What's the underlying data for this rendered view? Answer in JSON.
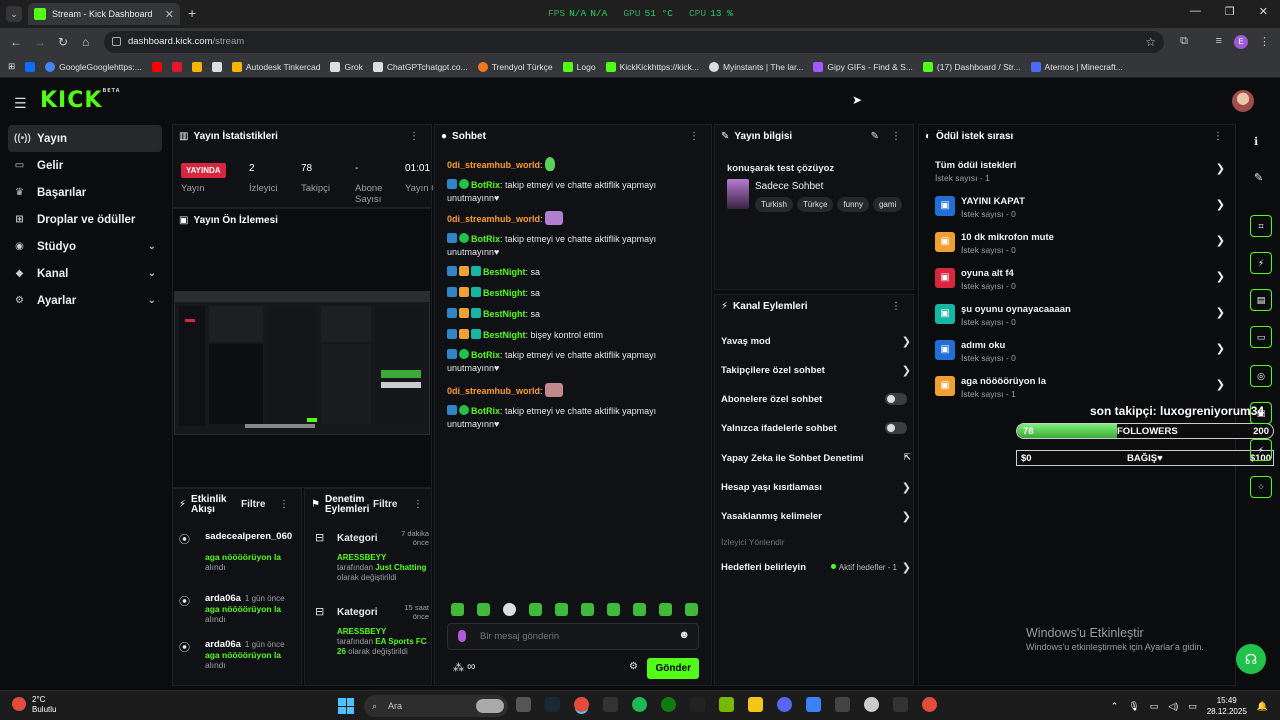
{
  "browser": {
    "tab_title": "Stream - Kick Dashboard",
    "hud": {
      "fps_label": "FPS",
      "fps_value": "N/A",
      "fps_value2": "N/A",
      "gpu_label": "GPU",
      "gpu_value": "51 °C",
      "cpu_label": "CPU",
      "cpu_value": "13 %"
    },
    "url_domain": "dashboard.kick.com",
    "url_path": "/stream",
    "profile_letter": "E",
    "bookmarks": [
      {
        "label": "GoogleGooglehttps:...",
        "color": "#4285f4"
      },
      {
        "label": "",
        "color": "#ff0000"
      },
      {
        "label": "",
        "color": "#e6162d"
      },
      {
        "label": "",
        "color": "#f5b400"
      },
      {
        "label": "Autodesk Tinkercad",
        "color": "#f5b400"
      },
      {
        "label": "Grok",
        "color": "#e0e0e0"
      },
      {
        "label": "ChatGPTchatgpt.co...",
        "color": "#e0e0e0"
      },
      {
        "label": "Trendyol Türkçe",
        "color": "#f27a1a"
      },
      {
        "label": "Logo",
        "color": "#53fc18"
      },
      {
        "label": "KickKickhttps://kick...",
        "color": "#53fc18"
      },
      {
        "label": "Myinstants | The lar...",
        "color": "#e0e0e0"
      },
      {
        "label": "Gipy GIFs - Find & S...",
        "color": "#a259ff"
      },
      {
        "label": "(17) Dashboard / Str...",
        "color": "#53fc18"
      },
      {
        "label": "Aternos | Minecraft...",
        "color": "#4a6cf7"
      }
    ]
  },
  "kick": {
    "logo": "KICK",
    "logo_sup": "BETA"
  },
  "sidebar": {
    "items": [
      {
        "label": "Yayın",
        "icon": "broadcast-icon",
        "glyph": "((•))",
        "chev": ""
      },
      {
        "label": "Gelir",
        "icon": "money-icon",
        "glyph": "▭",
        "chev": ""
      },
      {
        "label": "Başarılar",
        "icon": "trophy-icon",
        "glyph": "🏆",
        "chev": ""
      },
      {
        "label": "Droplar ve ödüller",
        "icon": "gift-icon",
        "glyph": "⊞",
        "chev": ""
      },
      {
        "label": "Stüdyo",
        "icon": "studio-icon",
        "glyph": "◉",
        "chev": "⌄"
      },
      {
        "label": "Kanal",
        "icon": "channel-icon",
        "glyph": "◆",
        "chev": "⌄"
      },
      {
        "label": "Ayarlar",
        "icon": "settings-icon",
        "glyph": "⚙",
        "chev": "⌄"
      }
    ]
  },
  "stats": {
    "title": "Yayın İstatistikleri",
    "live_badge": "YAYINDA",
    "live_label": "Yayın",
    "viewers": "2",
    "viewers_label": "İzleyici",
    "followers": "78",
    "followers_label": "Takipçi",
    "subs": "-",
    "subs_label": "Abone Sayısı",
    "time": "01:01",
    "time_label": "Yayın Oldu"
  },
  "preview": {
    "title": "Yayın Ön İzlemesi"
  },
  "activity": {
    "title": "Etkinlik Akışı",
    "filter": "Filtre",
    "items": [
      {
        "name": "sadecealperen_060",
        "time": "",
        "reward": "aga nöööörüyon la",
        "sub": "alındı"
      },
      {
        "name": "arda06a",
        "time": "1 gün önce",
        "reward": "aga nöööörüyon la",
        "sub": "alındı"
      },
      {
        "name": "arda06a",
        "time": "1 gün önce",
        "reward": "aga nöööörüyon la",
        "sub": "alındı"
      }
    ]
  },
  "audit": {
    "title": "Denetim Eylemleri",
    "filter": "Filtre",
    "items": [
      {
        "label": "Kategori",
        "time": "7 dakika önce",
        "user": "ARESSBEYY",
        "by": "tarafından",
        "game": "Just Chatting",
        "end": "olarak değiştirildi"
      },
      {
        "label": "Kategori",
        "time": "15 saat önce",
        "user": "ARESSBEYY",
        "by": "tarafından",
        "game": "EA Sports FC 26",
        "end": "olarak değiştirildi"
      }
    ]
  },
  "chat": {
    "title": "Sohbet",
    "lines": [
      {
        "name": "0di_streamhub_world",
        "type": "odi",
        "text": ""
      },
      {
        "name": "BotRix",
        "type": "bot",
        "text": "takip etmeyi ve chatte aktiflik yapmayı unutmayınn♥"
      },
      {
        "name": "0di_streamhub_world",
        "type": "odi",
        "text": ""
      },
      {
        "name": "BotRix",
        "type": "bot",
        "text": "takip etmeyi ve chatte aktiflik yapmayı unutmayınn♥"
      },
      {
        "name": "BestNight",
        "type": "best",
        "text": "sa"
      },
      {
        "name": "BestNight",
        "type": "best",
        "text": "sa"
      },
      {
        "name": "BestNight",
        "type": "best",
        "text": "sa"
      },
      {
        "name": "BestNight",
        "type": "best",
        "text": "bişey kontrol ettim"
      },
      {
        "name": "BotRix",
        "type": "bot",
        "text": "takip etmeyi ve chatte aktiflik yapmayı unutmayınn♥"
      },
      {
        "name": "0di_streamhub_world",
        "type": "odi",
        "text": ""
      },
      {
        "name": "BotRix",
        "type": "bot",
        "text": "takip etmeyi ve chatte aktiflik yapmayı unutmayınn♥"
      }
    ],
    "placeholder": "Bir mesaj gönderin",
    "send": "Gönder"
  },
  "stream_info": {
    "title": "Yayın bilgisi",
    "stream_title": "konuşarak test çözüyoz",
    "category": "Sadece Sohbet",
    "tags": [
      "Turkish",
      "Türkçe",
      "funny",
      "gami"
    ]
  },
  "channel_actions": {
    "title": "Kanal Eylemleri",
    "items": [
      {
        "label": "Yavaş mod",
        "kind": "arrow"
      },
      {
        "label": "Takipçilere özel sohbet",
        "kind": "arrow"
      },
      {
        "label": "Abonelere özel sohbet",
        "kind": "toggle"
      },
      {
        "label": "Yalnızca ifadelerle sohbet",
        "kind": "toggle"
      },
      {
        "label": "Yapay Zeka ile Sohbet Denetimi",
        "kind": "ext"
      },
      {
        "label": "Hesap yaşı kısıtlaması",
        "kind": "arrow"
      },
      {
        "label": "Yasaklanmış kelimeler",
        "kind": "arrow"
      }
    ],
    "section": "İzleyici Yönlendir",
    "goals_label": "Hedefleri belirleyin",
    "goals_value": "Aktif hedefler - 1"
  },
  "rewards": {
    "title": "Ödül istek sırası",
    "all_label": "Tüm ödül istekleri",
    "all_sub": "İstek sayısı - 1",
    "items": [
      {
        "title": "YAYINI KAPAT",
        "sub": "İstek sayısı - 0",
        "color": "#1f6fd6"
      },
      {
        "title": "10 dk mikrofon mute",
        "sub": "İstek sayısı - 0",
        "color": "#f0a030"
      },
      {
        "title": "oyuna alt f4",
        "sub": "İstek sayısı - 0",
        "color": "#d7263d"
      },
      {
        "title": "şu oyunu oynayacaaaan",
        "sub": "İstek sayısı - 0",
        "color": "#17b6a3"
      },
      {
        "title": "adımı oku",
        "sub": "İstek sayısı - 0",
        "color": "#1f6fd6"
      },
      {
        "title": "aga nöööörüyon la",
        "sub": "İstek sayısı - 1",
        "color": "#f0a030"
      }
    ]
  },
  "overlay": {
    "last_follower": "son takipçi: luxogreniyorum34",
    "followers_current": "78",
    "followers_label": "FOLLOWERS",
    "followers_goal": "200",
    "followers_progress": 0.39,
    "donation_current": "$0",
    "donation_label": "BAĞIŞ♥",
    "donation_goal": "$100"
  },
  "windows": {
    "activate_title": "Windows'u Etkinleştir",
    "activate_sub": "Windows'u etkinleştirmek için Ayarlar'a gidin.",
    "weather_temp": "2°C",
    "weather_desc": "Bulutlu",
    "search": "Ara",
    "time": "15:49",
    "date": "28.12.2025"
  }
}
